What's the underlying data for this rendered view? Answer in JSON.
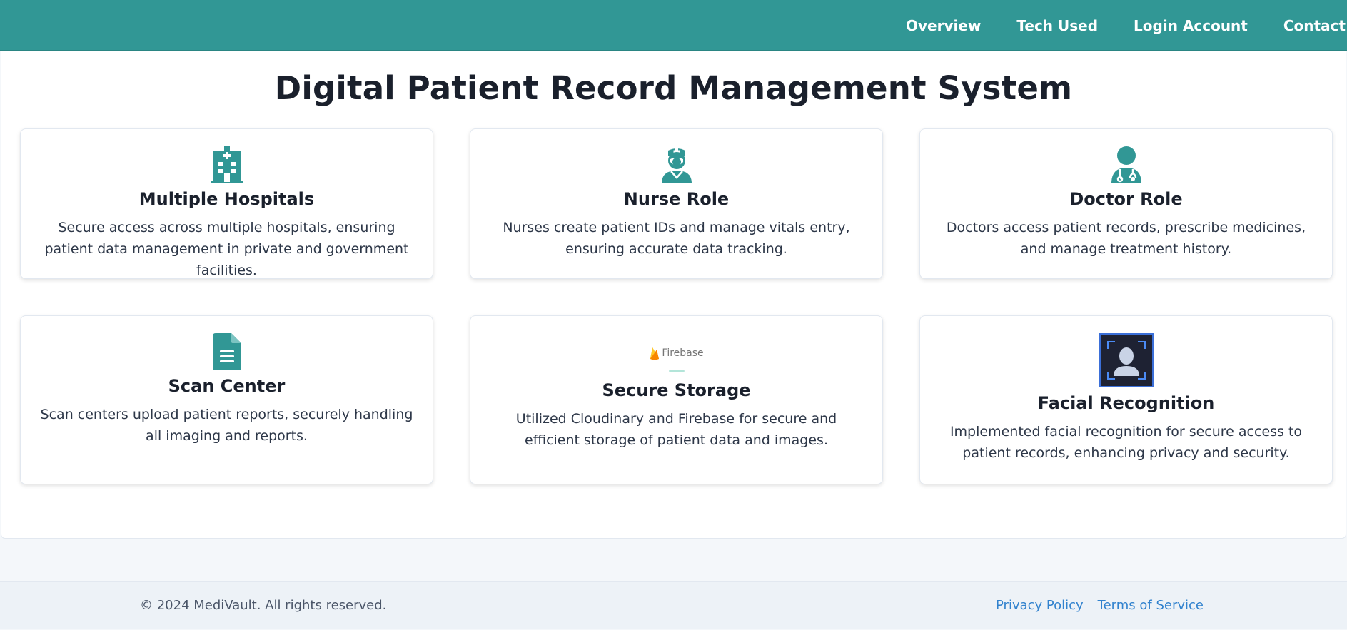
{
  "nav": {
    "links": [
      "Overview",
      "Tech Used",
      "Login Account",
      "Contact"
    ]
  },
  "main": {
    "title": "Digital Patient Record Management System",
    "cards": [
      {
        "icon": "hospital-icon",
        "title": "Multiple Hospitals",
        "desc": "Secure access across multiple hospitals, ensuring patient data management in private and government facilities."
      },
      {
        "icon": "nurse-icon",
        "title": "Nurse Role",
        "desc": "Nurses create patient IDs and manage vitals entry, ensuring accurate data tracking."
      },
      {
        "icon": "doctor-icon",
        "title": "Doctor Role",
        "desc": "Doctors access patient records, prescribe medicines, and manage treatment history."
      },
      {
        "icon": "document-icon",
        "title": "Scan Center",
        "desc": "Scan centers upload patient reports, securely handling all imaging and reports."
      },
      {
        "icon": "firebase-logo",
        "logo_text": "Firebase",
        "title": "Secure Storage",
        "desc": "Utilized Cloudinary and Firebase for secure and efficient storage of patient data and images."
      },
      {
        "icon": "face-recognition-icon",
        "title": "Facial Recognition",
        "desc": "Implemented facial recognition for secure access to patient records, enhancing privacy and security."
      }
    ]
  },
  "footer": {
    "copyright": "© 2024 MediVault. All rights reserved.",
    "links": [
      "Privacy Policy",
      "Terms of Service"
    ]
  },
  "colors": {
    "accent": "#319795",
    "link": "#3182ce"
  }
}
